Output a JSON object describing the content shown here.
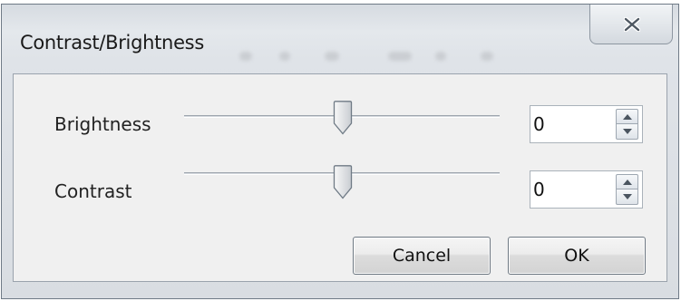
{
  "window": {
    "title": "Contrast/Brightness",
    "close_icon": "close-icon"
  },
  "brightness": {
    "label": "Brightness",
    "value": "0",
    "slider_level": 0.5
  },
  "contrast": {
    "label": "Contrast",
    "value": "0",
    "slider_level": 0.5
  },
  "buttons": {
    "cancel_label": "Cancel",
    "ok_label": "OK"
  },
  "colors": {
    "frame_border": "#6f7a86",
    "client_background": "#f0f0f0",
    "titlebar": "#e4e8ec"
  }
}
